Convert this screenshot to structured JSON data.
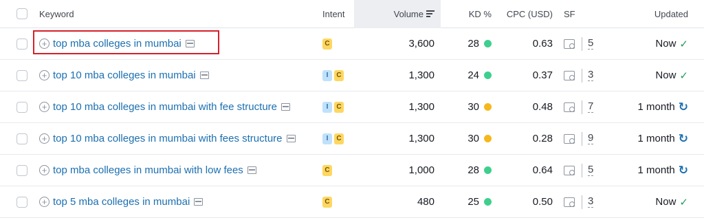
{
  "header": {
    "keyword": "Keyword",
    "intent": "Intent",
    "volume": "Volume",
    "kd": "KD %",
    "cpc": "CPC (USD)",
    "sf": "SF",
    "updated": "Updated"
  },
  "colors": {
    "link": "#1b6fb0",
    "kd_green": "#3ecf8e",
    "kd_yellow": "#f5b81b",
    "highlight": "#d5202a"
  },
  "rows": [
    {
      "keyword": "top mba colleges in mumbai",
      "intents": [
        "C"
      ],
      "volume": "3,600",
      "kd": "28",
      "kd_color": "#3ecf8e",
      "cpc": "0.63",
      "sf": "5",
      "updated": "Now",
      "updated_icon": "check-icon"
    },
    {
      "keyword": "top 10 mba colleges in mumbai",
      "intents": [
        "I",
        "C"
      ],
      "volume": "1,300",
      "kd": "24",
      "kd_color": "#3ecf8e",
      "cpc": "0.37",
      "sf": "3",
      "updated": "Now",
      "updated_icon": "check-icon"
    },
    {
      "keyword": "top 10 mba colleges in mumbai with fee structure",
      "intents": [
        "I",
        "C"
      ],
      "volume": "1,300",
      "kd": "30",
      "kd_color": "#f5b81b",
      "cpc": "0.48",
      "sf": "7",
      "updated": "1 month",
      "updated_icon": "refresh-icon"
    },
    {
      "keyword": "top 10 mba colleges in mumbai with fees structure",
      "intents": [
        "I",
        "C"
      ],
      "volume": "1,300",
      "kd": "30",
      "kd_color": "#f5b81b",
      "cpc": "0.28",
      "sf": "9",
      "updated": "1 month",
      "updated_icon": "refresh-icon"
    },
    {
      "keyword": "top mba colleges in mumbai with low fees",
      "intents": [
        "C"
      ],
      "volume": "1,000",
      "kd": "28",
      "kd_color": "#3ecf8e",
      "cpc": "0.64",
      "sf": "5",
      "updated": "1 month",
      "updated_icon": "refresh-icon"
    },
    {
      "keyword": "top 5 mba colleges in mumbai",
      "intents": [
        "C"
      ],
      "volume": "480",
      "kd": "25",
      "kd_color": "#3ecf8e",
      "cpc": "0.50",
      "sf": "3",
      "updated": "Now",
      "updated_icon": "check-icon"
    }
  ]
}
